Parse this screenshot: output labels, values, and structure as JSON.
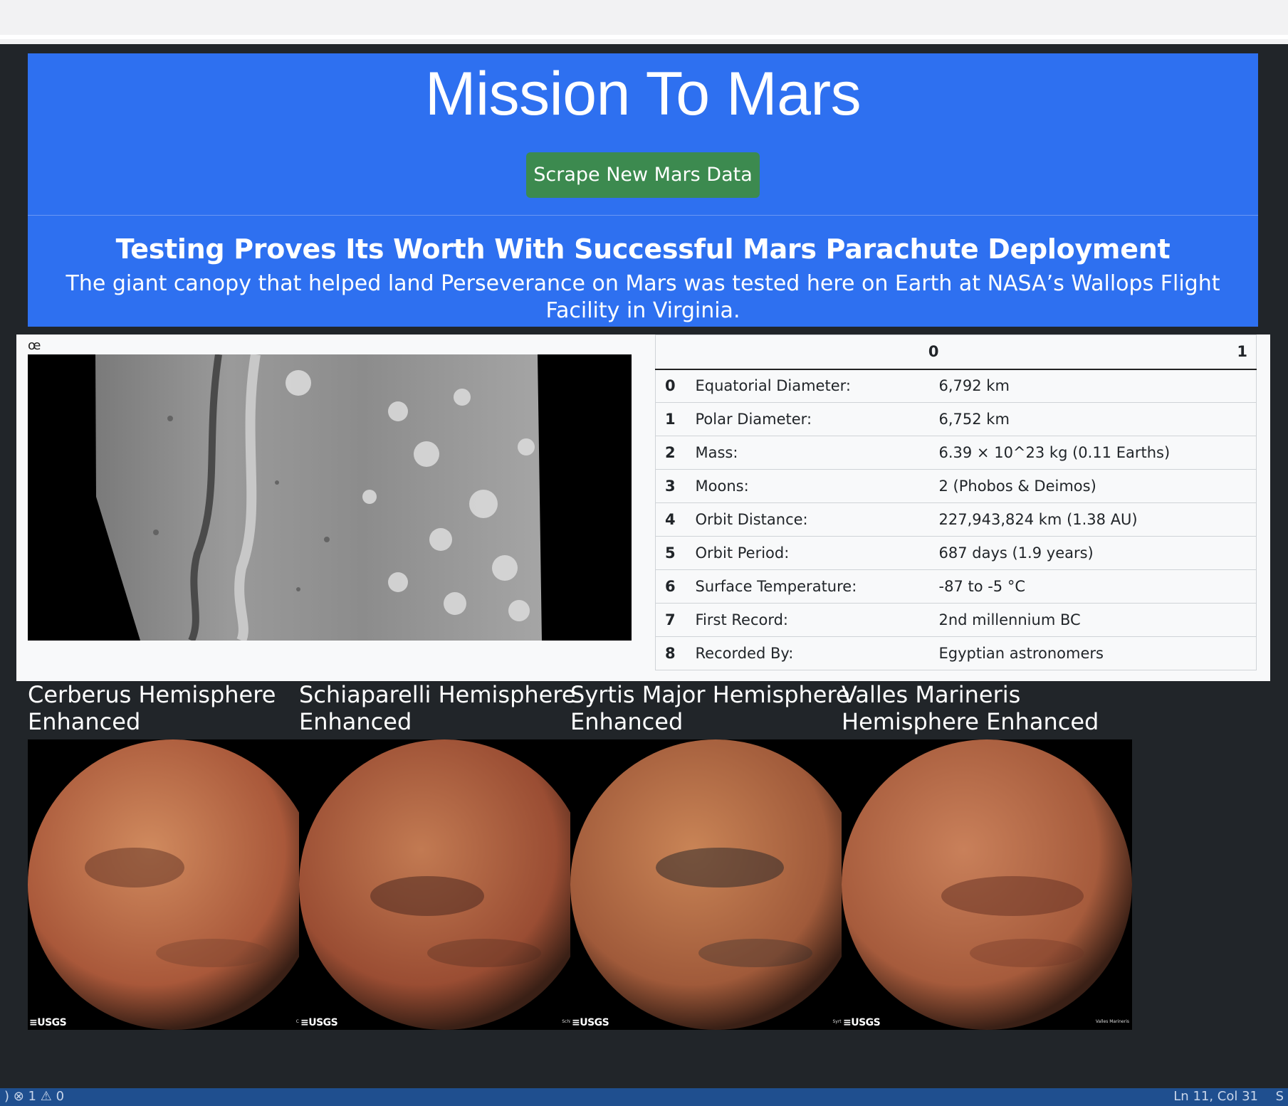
{
  "header": {
    "title": "Mission To Mars",
    "scrape_button": "Scrape New Mars Data"
  },
  "news": {
    "title": "Testing Proves Its Worth With Successful Mars Parachute Deployment",
    "paragraph": "The giant canopy that helped land Perseverance on Mars was tested here on Earth at NASA’s Wallops Flight Facility in Virginia."
  },
  "featured_image": {
    "alt_text": "œ"
  },
  "facts": {
    "headers": [
      "0",
      "1"
    ],
    "rows": [
      {
        "index": "0",
        "label": "Equatorial Diameter:",
        "value": "6,792 km"
      },
      {
        "index": "1",
        "label": "Polar Diameter:",
        "value": "6,752 km"
      },
      {
        "index": "2",
        "label": "Mass:",
        "value": "6.39 × 10^23 kg (0.11 Earths)"
      },
      {
        "index": "3",
        "label": "Moons:",
        "value": "2 (Phobos & Deimos)"
      },
      {
        "index": "4",
        "label": "Orbit Distance:",
        "value": "227,943,824 km (1.38 AU)"
      },
      {
        "index": "5",
        "label": "Orbit Period:",
        "value": "687 days (1.9 years)"
      },
      {
        "index": "6",
        "label": "Surface Temperature:",
        "value": "-87 to -5 °C"
      },
      {
        "index": "7",
        "label": "First Record:",
        "value": "2nd millennium BC"
      },
      {
        "index": "8",
        "label": "Recorded By:",
        "value": "Egyptian astronomers"
      }
    ]
  },
  "hemispheres": [
    {
      "title": "Cerberus Hemisphere Enhanced",
      "logo": "≡USGS",
      "caption": "Cerberus"
    },
    {
      "title": "Schiaparelli Hemisphere Enhanced",
      "logo": "≡USGS",
      "caption": "Schiaparelli"
    },
    {
      "title": "Syrtis Major Hemisphere Enhanced",
      "logo": "≡USGS",
      "caption": "Syrtis Major"
    },
    {
      "title": "Valles Marineris Hemisphere Enhanced",
      "logo": "≡USGS",
      "caption": "Valles Marineris"
    }
  ],
  "statusbar": {
    "left": ")   ⊗ 1 ⚠ 0",
    "right": "Ln 11, Col 31",
    "right_edge": "S"
  },
  "colors": {
    "jumbotron": "#2e70f0",
    "button": "#3c8a4f",
    "page_bg": "#212529",
    "mars": "#b8603a"
  }
}
